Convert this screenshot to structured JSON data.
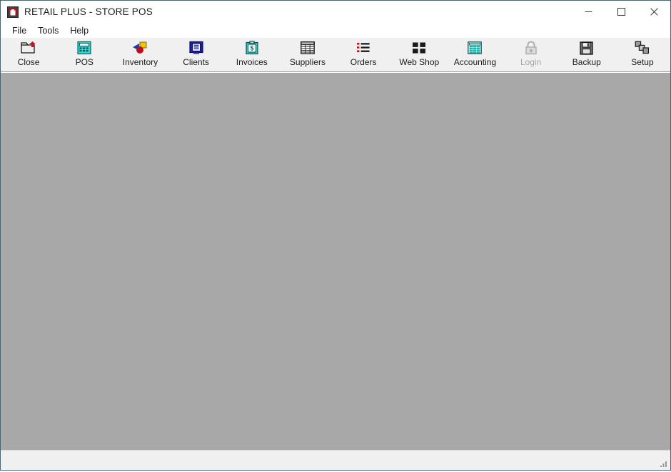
{
  "window": {
    "title": "RETAIL PLUS  -  STORE POS",
    "app_icon": "retail-plus-logo-icon",
    "controls": {
      "minimize": "minimize-icon",
      "maximize": "maximize-icon",
      "close": "close-icon"
    },
    "colors": {
      "titlebar_bg": "#ffffff",
      "toolbar_bg": "#f0f0f0",
      "client_bg": "#a8a8a8",
      "statusbar_bg": "#f0f0f0",
      "window_border": "#4a6572",
      "text": "#1b1b1b",
      "disabled_text": "#a6a6a6",
      "accent_red": "#d40b19",
      "accent_teal": "#13b3ad"
    }
  },
  "menubar": {
    "items": [
      {
        "label": "File",
        "name": "menu-file"
      },
      {
        "label": "Tools",
        "name": "menu-tools"
      },
      {
        "label": "Help",
        "name": "menu-help"
      }
    ]
  },
  "toolbar": {
    "buttons": [
      {
        "label": "Close",
        "icon": "folder-close-icon",
        "enabled": true
      },
      {
        "label": "POS",
        "icon": "calculator-icon",
        "enabled": true
      },
      {
        "label": "Inventory",
        "icon": "shapes-inventory-icon",
        "enabled": true
      },
      {
        "label": "Clients",
        "icon": "monitor-clients-icon",
        "enabled": true
      },
      {
        "label": "Invoices",
        "icon": "clipboard-dollar-icon",
        "enabled": true
      },
      {
        "label": "Suppliers",
        "icon": "table-grid-icon",
        "enabled": true
      },
      {
        "label": "Orders",
        "icon": "ordered-list-icon",
        "enabled": true
      },
      {
        "label": "Web Shop",
        "icon": "window-tiles-icon",
        "enabled": true
      },
      {
        "label": "Accounting",
        "icon": "spreadsheet-icon",
        "enabled": true
      },
      {
        "label": "Login",
        "icon": "padlock-icon",
        "enabled": false
      },
      {
        "label": "Backup",
        "icon": "floppy-disk-icon",
        "enabled": true
      },
      {
        "label": "Setup",
        "icon": "components-setup-icon",
        "enabled": true
      }
    ]
  },
  "client": {
    "content": ""
  },
  "statusbar": {
    "text": "",
    "resize_grip": "resize-grip-icon"
  }
}
